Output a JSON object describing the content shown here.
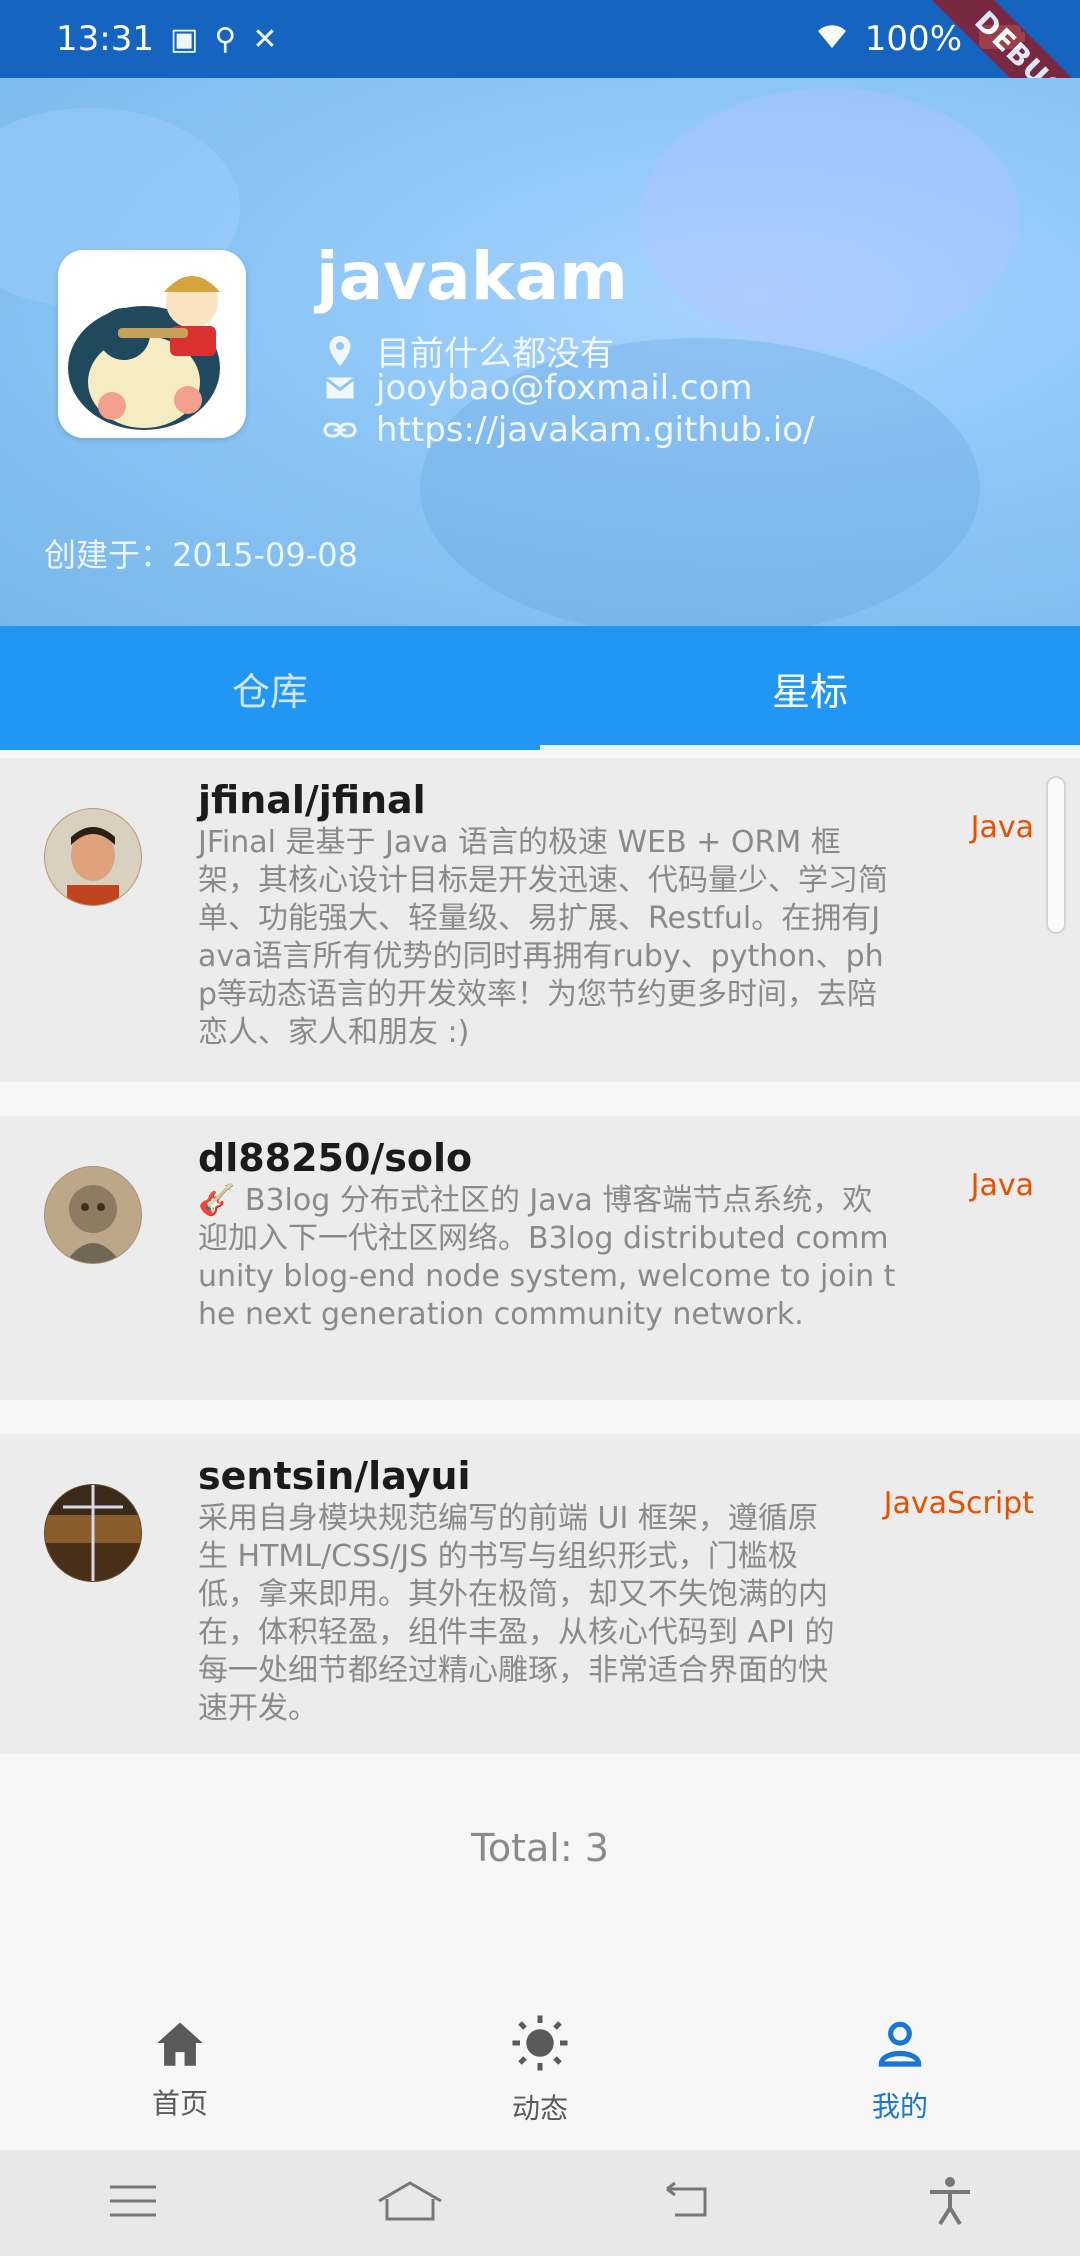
{
  "status_bar": {
    "time": "13:31",
    "battery": "100%",
    "icons": [
      "sim-icon",
      "app-icon",
      "usb-icon",
      "tools-icon",
      "wifi-icon",
      "battery-icon"
    ]
  },
  "debug_banner": "DEBUG",
  "profile": {
    "username": "javakam",
    "location": "目前什么都没有",
    "email": "jooybao@foxmail.com",
    "blog": "https://javakam.github.io/",
    "created": "创建于：2015-09-08"
  },
  "tabs": [
    {
      "label": "仓库",
      "active": false
    },
    {
      "label": "星标",
      "active": true
    }
  ],
  "repos": [
    {
      "name": "jfinal/jfinal",
      "description": "JFinal 是基于 Java 语言的极速 WEB + ORM 框架，其核心设计目标是开发迅速、代码量少、学习简单、功能强大、轻量级、易扩展、Restful。在拥有Java语言所有优势的同时再拥有ruby、python、php等动态语言的开发效率！为您节约更多时间，去陪恋人、家人和朋友 :)",
      "language": "Java"
    },
    {
      "name": "dl88250/solo",
      "description": "🎸 B3log 分布式社区的 Java 博客端节点系统，欢迎加入下一代社区网络。B3log distributed community blog-end node system, welcome to join the next generation community network.",
      "language": "Java"
    },
    {
      "name": "sentsin/layui",
      "description": "采用自身模块规范编写的前端 UI 框架，遵循原生 HTML/CSS/JS 的书写与组织形式，门槛极低，拿来即用。其外在极简，却又不失饱满的内在，体积轻盈，组件丰盈，从核心代码到 API 的每一处细节都经过精心雕琢，非常适合界面的快速开发。",
      "language": "JavaScript"
    }
  ],
  "total": "Total: 3",
  "bottom_nav": [
    {
      "label": "首页",
      "icon": "home-icon",
      "active": false
    },
    {
      "label": "动态",
      "icon": "sun-icon",
      "active": false
    },
    {
      "label": "我的",
      "icon": "person-icon",
      "active": true
    }
  ],
  "colors": {
    "primary": "#2196f3",
    "status_bar": "#1565c0",
    "language": "#e65100",
    "nav_active": "#1976d2"
  }
}
